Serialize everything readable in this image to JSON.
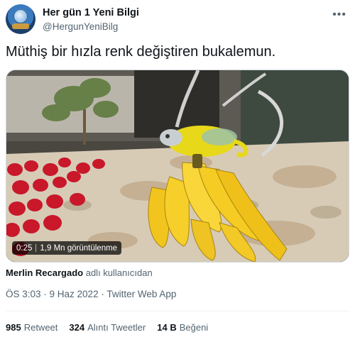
{
  "author": {
    "display_name": "Her gün 1 Yeni Bilgi",
    "handle": "@HergunYeniBilg",
    "avatar_icon": "globe-trophy-avatar"
  },
  "more_icon": "more-horizontal-icon",
  "tweet": {
    "text": "Müthiş bir hızla renk değiştiren bukalemun."
  },
  "media": {
    "type": "video",
    "duration": "0:25",
    "views": "1,9 Mn görüntülenme",
    "description_icon": "video-thumbnail"
  },
  "attribution": {
    "author": "Merlin Recargado",
    "suffix": "adlı kullanıcıdan"
  },
  "meta": {
    "time_date_source": "ÖS 3:03 · 9 Haz 2022 · Twitter Web App"
  },
  "stats": {
    "retweets_count": "985",
    "retweets_label": "Retweet",
    "quotes_count": "324",
    "quotes_label": "Alıntı Tweetler",
    "likes_count": "14 B",
    "likes_label": "Beğeni"
  }
}
